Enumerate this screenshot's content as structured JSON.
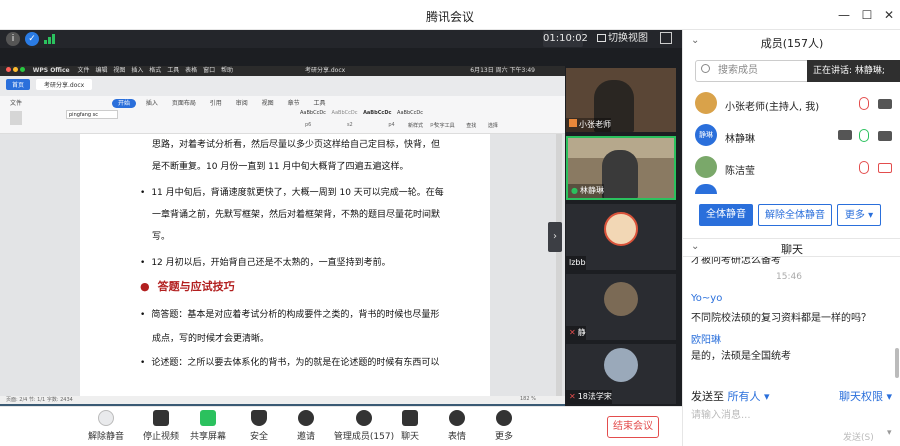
{
  "window": {
    "title": "腾讯会议"
  },
  "meeting": {
    "timer": "01:10:02",
    "switch_view_label": "切换视图"
  },
  "wps": {
    "app_name": "WPS Office",
    "menus": [
      "文件",
      "编辑",
      "视图",
      "插入",
      "格式",
      "工具",
      "表格",
      "窗口",
      "帮助"
    ],
    "doc_title": "考研分享.docx",
    "home_tab": "首页",
    "file_tab": "考研分享.docx",
    "ribbon_tabs": [
      "文件",
      "开始",
      "插入",
      "页面布局",
      "引用",
      "审阅",
      "视图",
      "章节",
      "工具"
    ],
    "active_tab": "开始",
    "font_name": "pingfang sc",
    "styles": [
      "AaBbCcDc",
      "AaBbCcDc",
      "AaBbCcDc",
      "AaBbCcDc"
    ],
    "style_names": [
      "p6",
      "s2",
      "p4",
      "p4"
    ],
    "right_tools": [
      "新样式",
      "文字工具",
      "查找",
      "选择"
    ],
    "status_left": "页面: 2/4  节: 1/1  字数: 2434",
    "status_zoom": "182 %",
    "clock": "6月13日 周六 下午3:49"
  },
  "document": {
    "lines": [
      {
        "text": "思路，对着考试分析看，然后尽量以多少页这样给自己定目标，快背，但",
        "bullet": false
      },
      {
        "text": "是不断重复。10 月份一直到 11 月中旬大概背了四遍五遍这样。",
        "bullet": false
      },
      {
        "text": "11 月中旬后，背诵速度就更快了，大概一周到 10 天可以完成一轮。在每",
        "bullet": true
      },
      {
        "text": "一章背诵之前，先默写框架，然后对着框架背，不熟的题目尽量花时间默",
        "bullet": false
      },
      {
        "text": "写。",
        "bullet": false
      },
      {
        "text": "12 月初以后，开始背自己还是不太熟的，一直坚持到考前。",
        "bullet": true
      }
    ],
    "heading": "答题与应试技巧",
    "lines2": [
      {
        "text": "简答题：基本是对应着考试分析的构成要件之类的，背书的时候也尽量形",
        "bullet": true
      },
      {
        "text": "成点，写的时候才会更清晰。",
        "bullet": false
      },
      {
        "text": "论述题：之所以要去体系化的背书，为的就是在论述题的时候有东西可以",
        "bullet": true
      }
    ]
  },
  "thumbnails": [
    {
      "name": "小张老师",
      "icon": "user-icon"
    },
    {
      "name": "林静琳",
      "icon": "mic-icon"
    },
    {
      "name": "lzbb",
      "icon": "none"
    },
    {
      "name": "静",
      "icon": "mic-off-icon"
    },
    {
      "name": "18法学宋",
      "icon": "mic-off-icon"
    }
  ],
  "toolbar": {
    "unmute": "解除静音",
    "stop_video": "停止视频",
    "share": "共享屏幕",
    "security": "安全",
    "invite": "邀请",
    "members": "管理成员(157)",
    "chat": "聊天",
    "emoji": "表情",
    "more": "更多",
    "end": "结束会议"
  },
  "members": {
    "title": "成员(157人)",
    "search_placeholder": "搜索成员",
    "speaking": "正在讲话: 林静琳;",
    "list": [
      {
        "name": "小张老师(主持人, 我)",
        "avatar": "#d9a24a",
        "mic_muted": true,
        "cam_on": true
      },
      {
        "name": "林静琳",
        "avatar": "#2a6fdb",
        "mic_muted": false,
        "cam_on": true
      },
      {
        "name": "陈洁莹",
        "avatar": "#7aa86a",
        "mic_muted": true,
        "cam_on": false
      }
    ],
    "avatar_text_2": "静琳",
    "mute_all": "全体静音",
    "unmute_all": "解除全体静音",
    "more": "更多"
  },
  "chat": {
    "title": "聊天",
    "partial_msg": "才被问考研怎么备考",
    "time": "15:46",
    "messages": [
      {
        "sender": "Yo~yo",
        "text": "不同院校法硕的复习资料都是一样的吗？"
      },
      {
        "sender": "欧阳琳",
        "text": "是的，法硕是全国统考"
      }
    ],
    "send_to_label": "发送至",
    "send_to_value": "所有人",
    "permissions": "聊天权限",
    "input_placeholder": "请输入消息...",
    "send_button": "发送(S)"
  }
}
